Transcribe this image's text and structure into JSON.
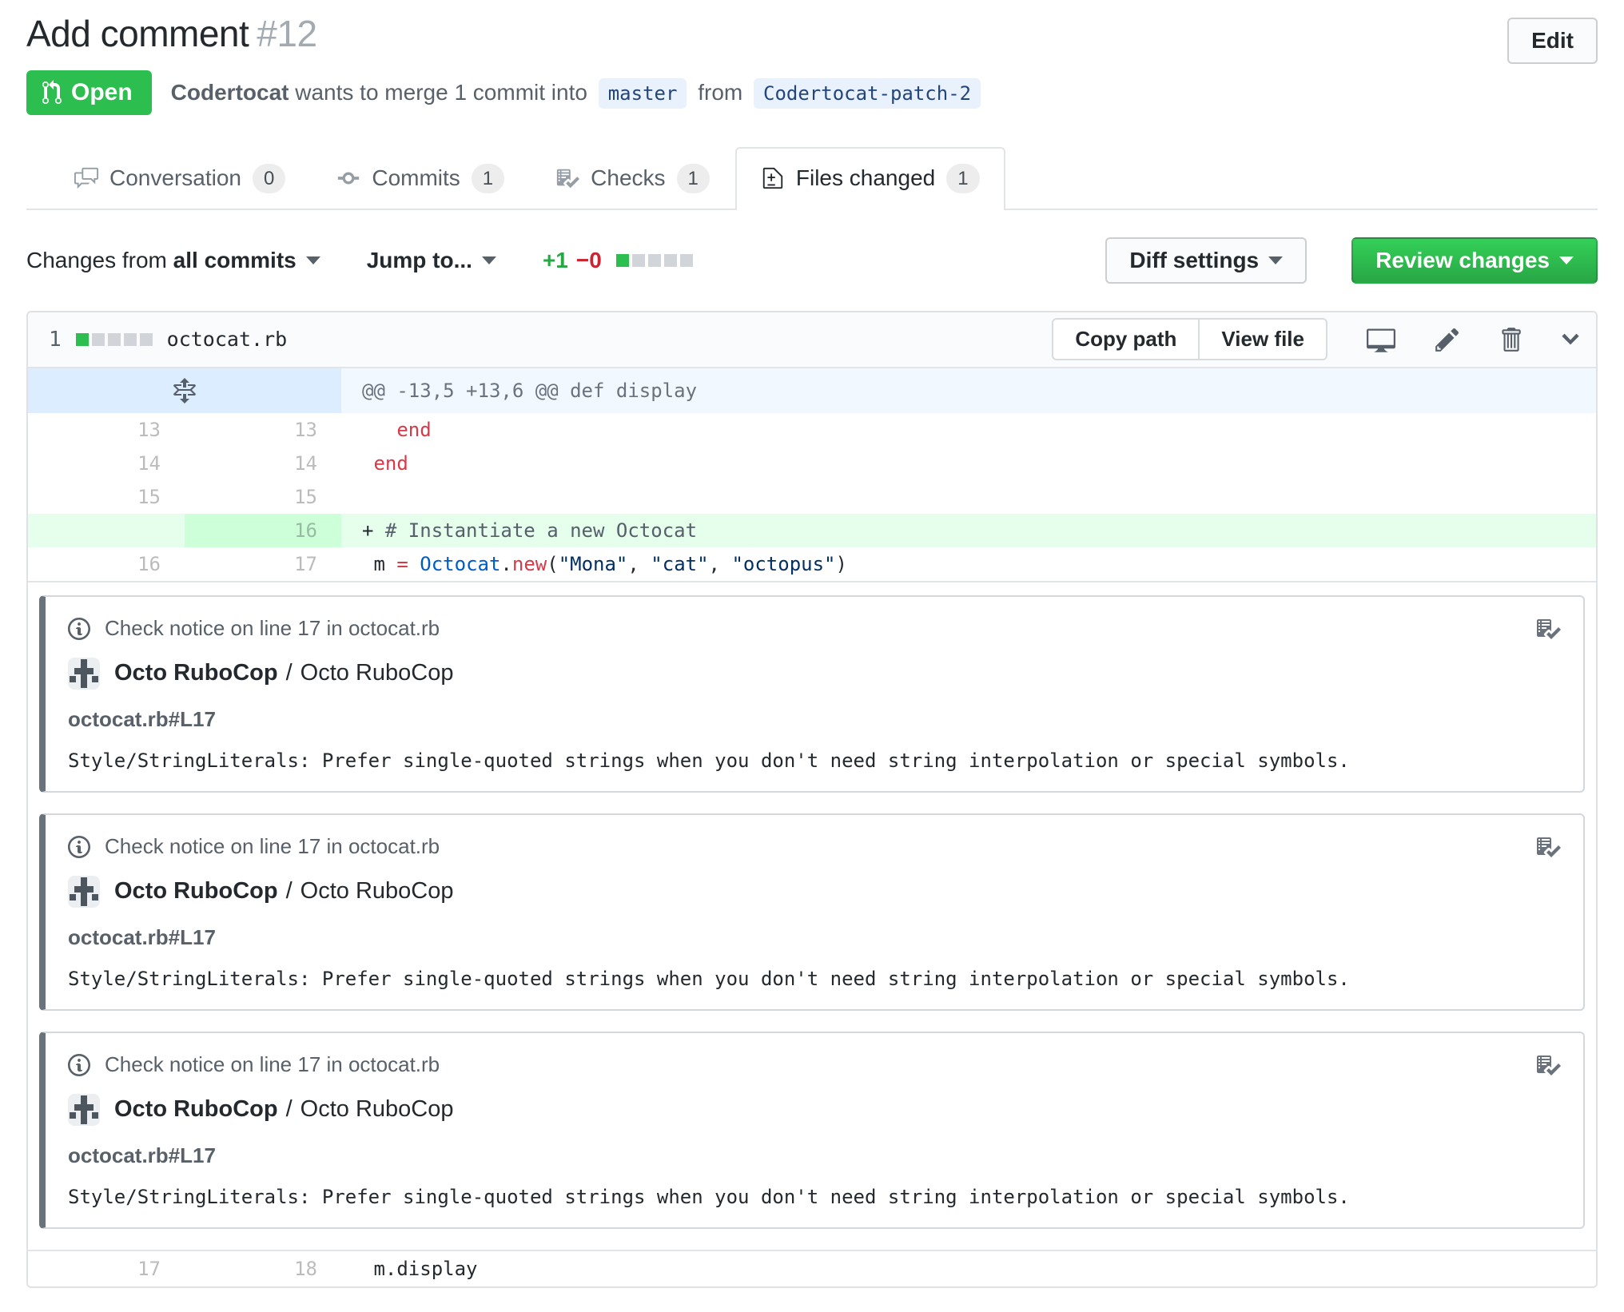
{
  "colors": {
    "open_green": "#2cbe4e",
    "review_button_green": "#28a745",
    "addition_bg": "#e6ffed",
    "addition_gutter_bg": "#cdffd8",
    "hunk_bg": "#f1f8ff",
    "notice_bar": "#6a737d"
  },
  "header": {
    "title": "Add comment",
    "number": "#12",
    "edit_button": "Edit",
    "state": "Open",
    "author": "Codertocat",
    "merge_text": "wants to merge 1 commit into",
    "base_branch": "master",
    "from_text": "from",
    "head_branch": "Codertocat-patch-2"
  },
  "tabs": [
    {
      "label": "Conversation",
      "count": "0"
    },
    {
      "label": "Commits",
      "count": "1"
    },
    {
      "label": "Checks",
      "count": "1"
    },
    {
      "label": "Files changed",
      "count": "1"
    }
  ],
  "toolbar": {
    "changes_from_label": "Changes from",
    "changes_from_value": "all commits",
    "jump_to_label": "Jump to...",
    "additions": "+1",
    "deletions": "−0",
    "diffstat_blocks": {
      "added": 1,
      "neutral": 4
    },
    "diff_settings_label": "Diff settings",
    "review_changes_label": "Review changes"
  },
  "file": {
    "stat_count": "1",
    "diffstat_blocks": {
      "added": 1,
      "neutral": 4
    },
    "filename": "octocat.rb",
    "copy_path_label": "Copy path",
    "view_file_label": "View file"
  },
  "diff": {
    "hunk_header": "@@ -13,5 +13,6 @@ def display",
    "rows": [
      {
        "old": "13",
        "new": "13",
        "type": "context",
        "segs": [
          {
            "t": "   ",
            "c": "pln"
          },
          {
            "t": "end",
            "c": "k"
          }
        ]
      },
      {
        "old": "14",
        "new": "14",
        "type": "context",
        "segs": [
          {
            "t": " ",
            "c": "pln"
          },
          {
            "t": "end",
            "c": "k"
          }
        ]
      },
      {
        "old": "15",
        "new": "15",
        "type": "context",
        "segs": []
      },
      {
        "old": "",
        "new": "16",
        "type": "addition",
        "segs": [
          {
            "t": "+ ",
            "c": "pln"
          },
          {
            "t": "# Instantiate a new Octocat",
            "c": "cmt"
          }
        ]
      },
      {
        "old": "16",
        "new": "17",
        "type": "context",
        "segs": [
          {
            "t": " ",
            "c": "pln"
          },
          {
            "t": "m ",
            "c": "pln"
          },
          {
            "t": "=",
            "c": "k"
          },
          {
            "t": " ",
            "c": "pln"
          },
          {
            "t": "Octocat",
            "c": "const"
          },
          {
            "t": ".",
            "c": "pln"
          },
          {
            "t": "new",
            "c": "k"
          },
          {
            "t": "(",
            "c": "pln"
          },
          {
            "t": "\"Mona\"",
            "c": "str"
          },
          {
            "t": ", ",
            "c": "pln"
          },
          {
            "t": "\"cat\"",
            "c": "str"
          },
          {
            "t": ", ",
            "c": "pln"
          },
          {
            "t": "\"octopus\"",
            "c": "str"
          },
          {
            "t": ")",
            "c": "pln"
          }
        ]
      },
      {
        "old": "17",
        "new": "18",
        "type": "context",
        "segs": [
          {
            "t": " ",
            "c": "pln"
          },
          {
            "t": "m.display",
            "c": "pln"
          }
        ]
      }
    ]
  },
  "notices": [
    {
      "header": "Check notice on line 17 in octocat.rb",
      "app_name": "Octo RuboCop",
      "separator": "/",
      "context_name": "Octo RuboCop",
      "location": "octocat.rb#L17",
      "message": "Style/StringLiterals: Prefer single-quoted strings when you don't need string interpolation or special symbols."
    },
    {
      "header": "Check notice on line 17 in octocat.rb",
      "app_name": "Octo RuboCop",
      "separator": "/",
      "context_name": "Octo RuboCop",
      "location": "octocat.rb#L17",
      "message": "Style/StringLiterals: Prefer single-quoted strings when you don't need string interpolation or special symbols."
    },
    {
      "header": "Check notice on line 17 in octocat.rb",
      "app_name": "Octo RuboCop",
      "separator": "/",
      "context_name": "Octo RuboCop",
      "location": "octocat.rb#L17",
      "message": "Style/StringLiterals: Prefer single-quoted strings when you don't need string interpolation or special symbols."
    }
  ]
}
